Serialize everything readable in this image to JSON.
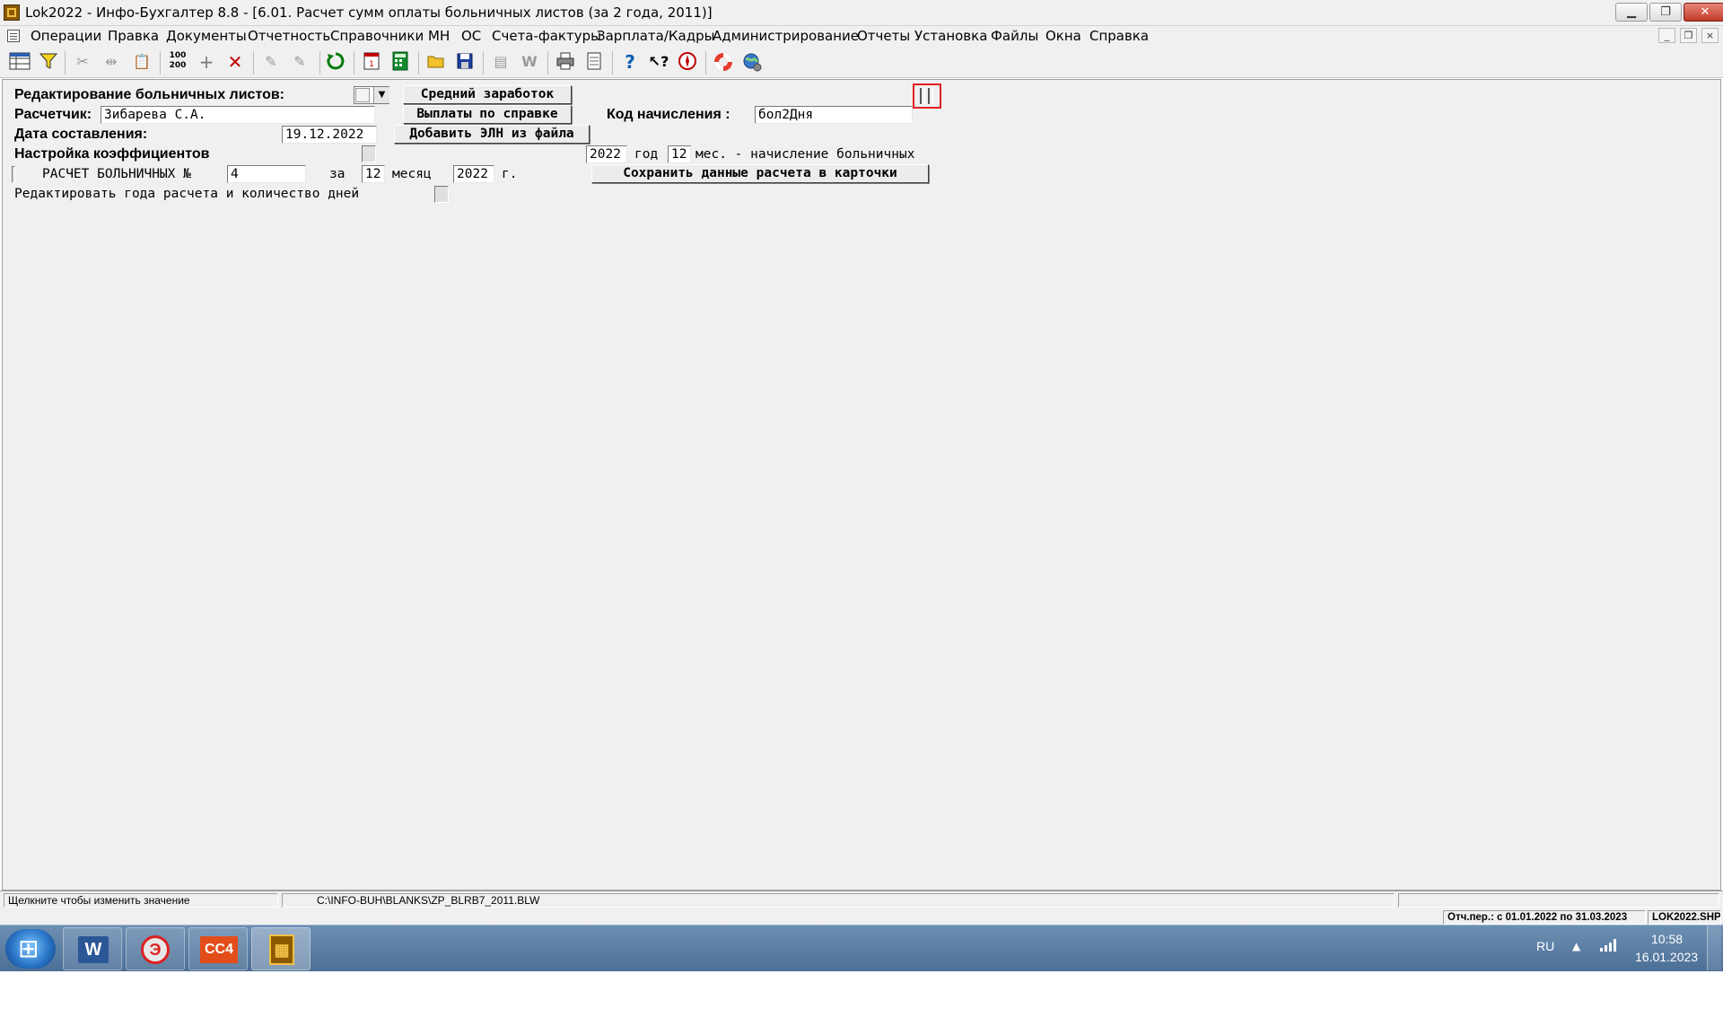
{
  "window": {
    "title": "Lok2022 - Инфо-Бухгалтер 8.8 - [6.01. Расчет сумм оплаты больничных листов (за 2 года, 2011)]"
  },
  "menu": [
    "Операции",
    "Правка",
    "Документы",
    "Отчетность",
    "Справочники",
    "МН",
    "ОС",
    "Счета-фактуры",
    "Зарплата/Кадры",
    "Администрирование",
    "Отчеты",
    "Установка",
    "Файлы",
    "Окна",
    "Справка"
  ],
  "toolbar_icons": [
    "grid-icon",
    "filter-icon",
    "cut-icon",
    "split-icon",
    "paste-icon",
    "counter-icon",
    "add-icon",
    "delete-icon",
    "mark-icon",
    "mark-all-icon",
    "refresh-icon",
    "calendar-icon",
    "calculator-icon",
    "open-folder-icon",
    "save-icon",
    "export-icon",
    "word-icon",
    "print-icon",
    "preview-icon",
    "help-icon",
    "context-help-icon",
    "compass-icon",
    "lifebuoy-icon",
    "web-icon"
  ],
  "form": {
    "heading": "Редактирование больничных листов:",
    "btn_avg": "Средний заработок",
    "btn_pay": "Выплаты по справке",
    "btn_add_eln": "Добавить ЭЛН из файла",
    "calc_label": "Расчетчик:",
    "calc_value": "Зибарева С.А.",
    "date_label": "Дата составления:",
    "date_value": "19.12.2022",
    "code_label": "Код начисления :",
    "code_value": "бол2Дня",
    "coef_label": "Настройка коэффициентов",
    "year_value": "2022",
    "year_text": "год",
    "months_value": "12",
    "months_text": "мес. - начисление больничных",
    "calc_no_label": "РАСЧЕТ БОЛЬНИЧНЫХ №",
    "calc_no_value": "4",
    "for_text": "за",
    "month_value": "12",
    "month_text": "месяц",
    "year2_value": "2022",
    "year2_text": "г.",
    "btn_save": "Сохранить данные расчета в карточки",
    "edit_years_label": "Редактировать года расчета и количество дней"
  },
  "status": {
    "hint": "Щелкните чтобы изменить значение",
    "path": "C:\\INFO-BUH\\BLANKS\\ZP_BLRB7_2011.BLW",
    "period": "Отч.пер.: с 01.01.2022 по 31.03.2023",
    "file": "LOK2022.SHP"
  },
  "taskbar": {
    "items": [
      "W",
      "Э",
      "CC4",
      "▦"
    ],
    "lang": "RU",
    "time": "10:58",
    "date": "16.01.2023"
  }
}
